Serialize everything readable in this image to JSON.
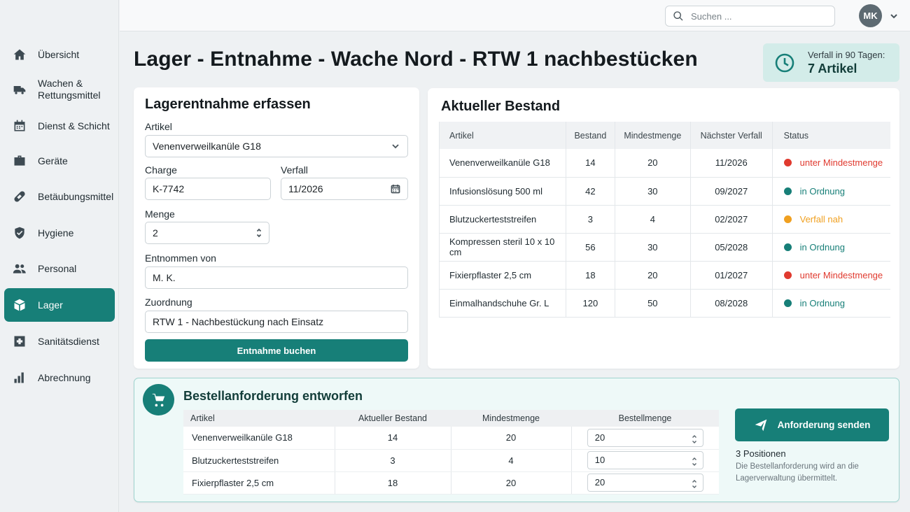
{
  "sidebar": {
    "items": [
      {
        "label": "Übersicht",
        "icon": "home-icon"
      },
      {
        "label": "Wachen &\nRettungsmittel",
        "icon": "ambulance-icon"
      },
      {
        "label": "Dienst & Schicht",
        "icon": "calendar-icon"
      },
      {
        "label": "Geräte",
        "icon": "briefcase-icon"
      },
      {
        "label": "Betäubungsmittel",
        "icon": "pill-icon"
      },
      {
        "label": "Hygiene",
        "icon": "shield-icon"
      },
      {
        "label": "Personal",
        "icon": "people-icon"
      },
      {
        "label": "Lager",
        "icon": "box-icon",
        "active": true
      },
      {
        "label": "Sanitätsdienst",
        "icon": "medical-cross-icon"
      },
      {
        "label": "Abrechnung",
        "icon": "bar-chart-icon"
      }
    ]
  },
  "topbar": {
    "search_placeholder": "Suchen ...",
    "user_initials": "MK"
  },
  "page": {
    "title": "Lager - Entnahme - Wache Nord - RTW 1 nachbestücken"
  },
  "expiry": {
    "label": "Verfall in 90 Tagen:",
    "value": "7 Artikel"
  },
  "form": {
    "title": "Lagerentnahme erfassen",
    "article_label": "Artikel",
    "article_value": "Venenverweilkanüle G18",
    "batch_label": "Charge",
    "batch_value": "K-7742",
    "expiry_label": "Verfall",
    "expiry_value": "11/2026",
    "qty_label": "Menge",
    "qty_value": "2",
    "taken_by_label": "Entnommen von",
    "taken_by_value": "M. K.",
    "assignment_label": "Zuordnung",
    "assignment_value": "RTW 1 - Nachbestückung nach Einsatz",
    "submit_label": "Entnahme buchen"
  },
  "stock": {
    "title": "Aktueller Bestand",
    "columns": [
      "Artikel",
      "Bestand",
      "Mindestmenge",
      "Nächster Verfall",
      "Status"
    ],
    "rows": [
      [
        "Venenverweilkanüle G18",
        "14",
        "20",
        "11/2026",
        "unter Mindestmenge"
      ],
      [
        "Infusionslösung 500 ml",
        "42",
        "30",
        "09/2027",
        "in Ordnung"
      ],
      [
        "Blutzuckerteststreifen",
        "3",
        "4",
        "02/2027",
        "Verfall nah"
      ],
      [
        "Kompressen steril 10 x 10 cm",
        "56",
        "30",
        "05/2028",
        "in Ordnung"
      ],
      [
        "Fixierpflaster 2,5 cm",
        "18",
        "20",
        "01/2027",
        "unter Mindestmenge"
      ],
      [
        "Einmalhandschuhe Gr. L",
        "120",
        "50",
        "08/2028",
        "in Ordnung"
      ]
    ],
    "status_colors": {
      "unter Mindestmenge": "#e03a2f",
      "in Ordnung": "#177f78",
      "Verfall nah": "#f0a020"
    }
  },
  "order": {
    "title": "Bestellanforderung entworfen",
    "columns": [
      "Artikel",
      "Aktueller Bestand",
      "Mindestmenge",
      "Bestellmenge"
    ],
    "rows": [
      [
        "Venenverweilkanüle G18",
        "14",
        "20",
        "20"
      ],
      [
        "Blutzuckerteststreifen",
        "3",
        "4",
        "10"
      ],
      [
        "Fixierpflaster 2,5 cm",
        "18",
        "20",
        "20"
      ]
    ],
    "send_label": "Anforderung senden",
    "positions": "3 Positionen",
    "note": "Die Bestellanforderung wird an die Lagerverwaltung übermittelt."
  },
  "colors": {
    "accent": "#177f78",
    "accent_light": "#d3ece9"
  }
}
